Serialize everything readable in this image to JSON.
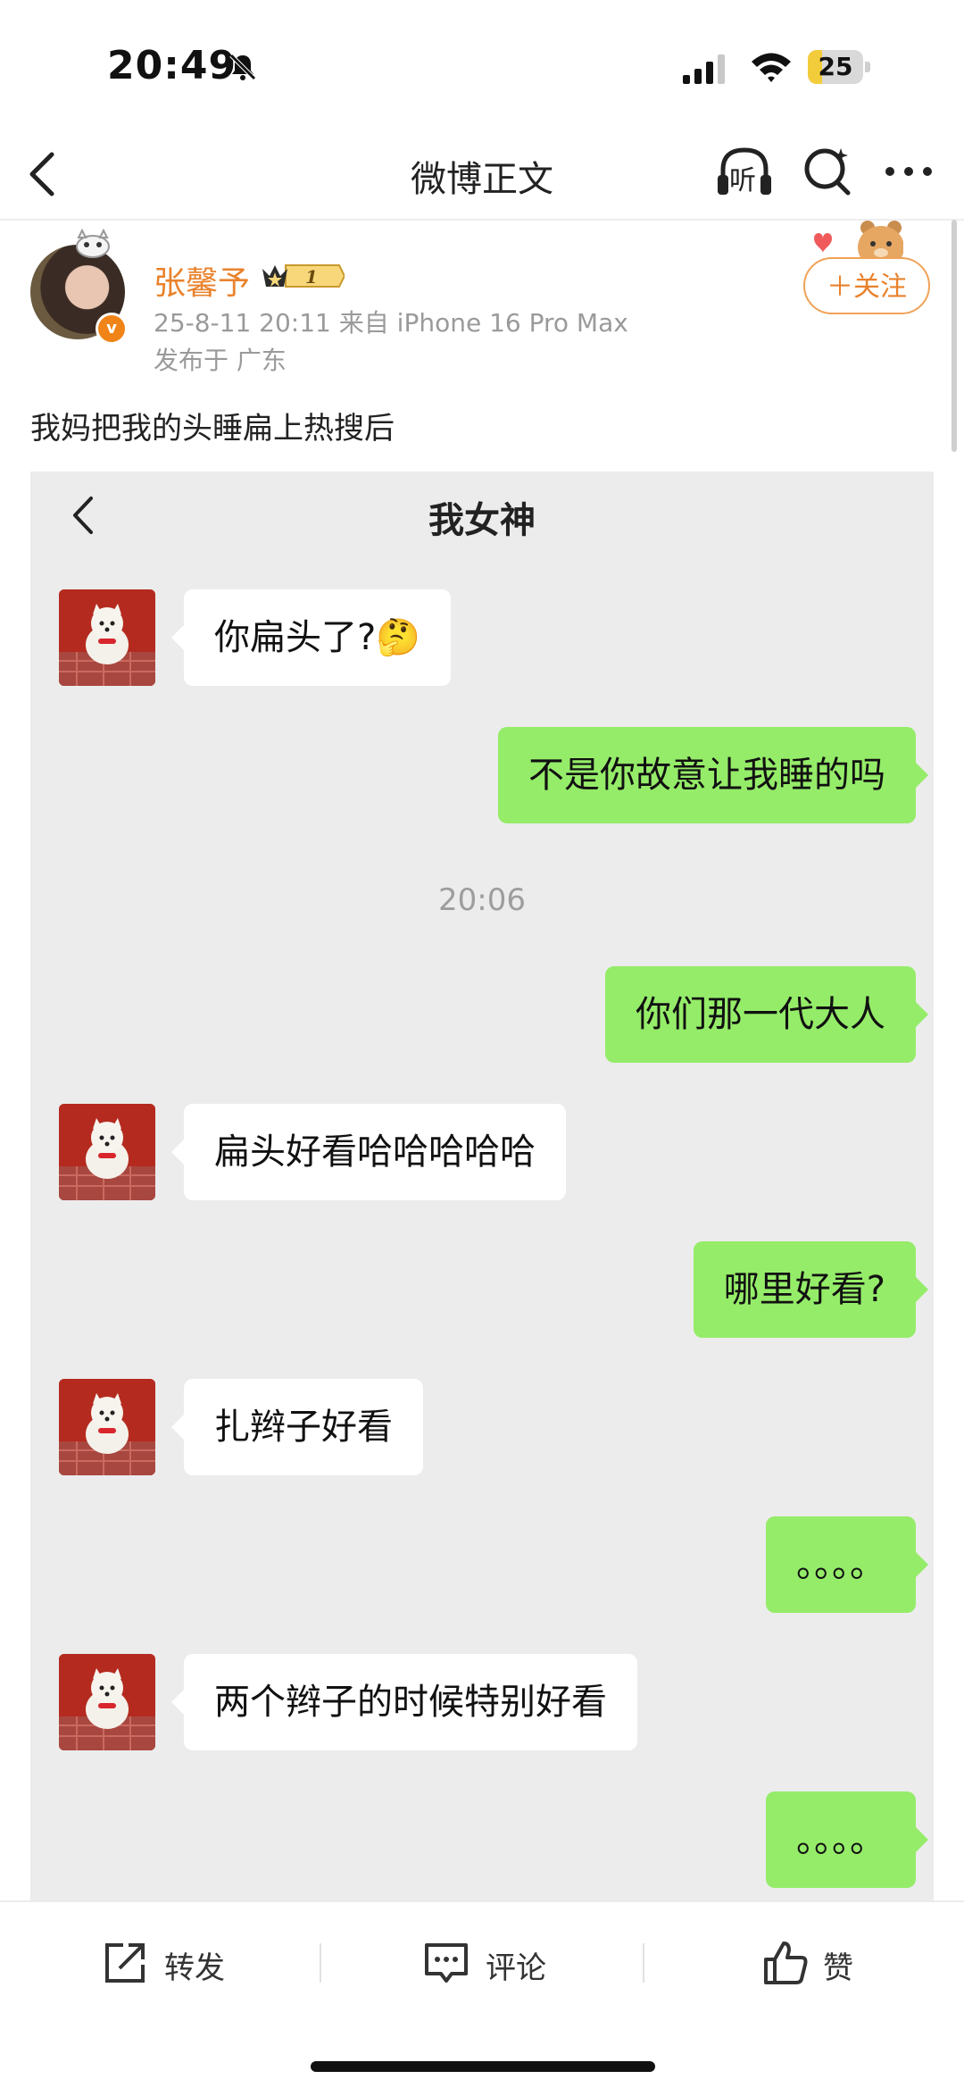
{
  "status_bar": {
    "time": "20:49",
    "battery": "25",
    "battery_level": 0.25
  },
  "nav": {
    "title": "微博正文",
    "listen_icon_text": "听"
  },
  "post": {
    "author_name": "张馨予",
    "vip_level": "1",
    "meta": "25-8-11 20:11  来自 iPhone 16 Pro Max",
    "location": "发布于 广东",
    "follow_label": "＋关注",
    "text": "我妈把我的头睡扁上热搜后"
  },
  "chat": {
    "title": "我女神",
    "time_divider": "20:06",
    "messages": [
      {
        "side": "left",
        "text": "你扁头了?🤔"
      },
      {
        "side": "right",
        "text": "不是你故意让我睡的吗"
      },
      {
        "side": "right",
        "text": "你们那一代大人"
      },
      {
        "side": "left",
        "text": "扁头好看哈哈哈哈哈"
      },
      {
        "side": "right",
        "text": "哪里好看?"
      },
      {
        "side": "left",
        "text": "扎辫子好看"
      },
      {
        "side": "right",
        "text": "。。。。"
      },
      {
        "side": "left",
        "text": "两个辫子的时候特别好看"
      },
      {
        "side": "right",
        "text": "。。。。"
      }
    ]
  },
  "actions": {
    "repost": "转发",
    "comment": "评论",
    "like": "赞"
  },
  "colors": {
    "accent": "#e9822c",
    "chat_green": "#95ec69",
    "chat_bg": "#ececec"
  }
}
